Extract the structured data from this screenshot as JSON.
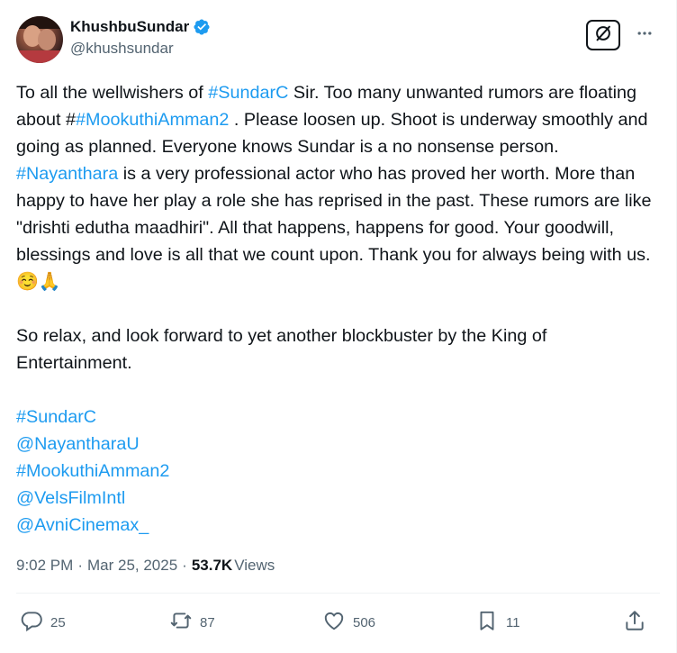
{
  "author": {
    "display_name": "KhushbuSundar",
    "handle": "@khushsundar",
    "verified": true
  },
  "tweet": {
    "paragraph1": [
      {
        "text": "To all the wellwishers of ",
        "type": "text"
      },
      {
        "text": "#SundarC",
        "type": "link"
      },
      {
        "text": " Sir. Too many unwanted rumors are floating about #",
        "type": "text"
      },
      {
        "text": "#MookuthiAmman2",
        "type": "link"
      },
      {
        "text": " . Please loosen up. Shoot is underway smoothly and going as planned. Everyone knows Sundar is a no nonsense person. ",
        "type": "text"
      },
      {
        "text": "#Nayanthara",
        "type": "link"
      },
      {
        "text": " is a very professional actor who has proved her worth. More than happy to have her play a role she has reprised in the past. These rumors are like \"drishti edutha maadhiri\". All that happens, happens for good. Your goodwill, blessings and love is all that we count upon. Thank you for always being with us. ",
        "type": "text"
      },
      {
        "text": "☺️🙏",
        "type": "emoji"
      }
    ],
    "paragraph2": "So relax, and look forward to yet another blockbuster by the King of Entertainment.",
    "tags": [
      "#SundarC",
      "@NayantharaU",
      "#MookuthiAmman2",
      "@VelsFilmIntl",
      "@AvniCinemax_"
    ]
  },
  "meta": {
    "time": "9:02 PM",
    "separator": "·",
    "date": "Mar 25, 2025",
    "views_count": "53.7K",
    "views_label": "Views"
  },
  "actions": {
    "replies": "25",
    "reposts": "87",
    "likes": "506",
    "bookmarks": "11"
  },
  "colors": {
    "link": "#1d9bf0",
    "text": "#0f1419",
    "secondary": "#536471",
    "verified": "#1d9bf0"
  },
  "icons": [
    "verified-icon",
    "grok-icon",
    "more-icon",
    "reply-icon",
    "repost-icon",
    "like-icon",
    "bookmark-icon",
    "share-icon"
  ]
}
